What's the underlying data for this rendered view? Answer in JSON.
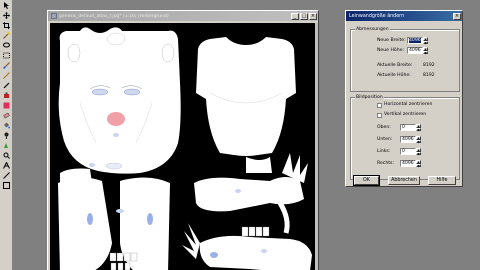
{
  "image_window": {
    "title": "genesis_default_atlas_f.jpg* (1:16) (Hintergrund)",
    "minimize": "_",
    "maximize": "□",
    "close": "×"
  },
  "dialog": {
    "title": "Leinwandgröße ändern",
    "close": "×",
    "dimensions_group": "Abmessungen",
    "new_width_label": "Neue Breite:",
    "new_width_value": "4096",
    "new_height_label": "Neue Höhe:",
    "new_height_value": "4096",
    "current_width_label": "Aktuelle Breite:",
    "current_width_value": "8192",
    "current_height_label": "Aktuelle Höhe:",
    "current_height_value": "8192",
    "position_group": "Bildposition",
    "center_horizontal_label": "Horizontal zentrieren",
    "center_vertical_label": "Vertikal zentrieren",
    "top_label": "Oben:",
    "top_value": "0",
    "bottom_label": "Unten:",
    "bottom_value": "4096",
    "left_label": "Links:",
    "left_value": "0",
    "right_label": "Rechts:",
    "right_value": "4096",
    "ok_label": "OK",
    "cancel_label": "Abbrechen",
    "help_label": "Hilfe"
  },
  "toolbox": {
    "tools": [
      "pointer-tool",
      "move-tool",
      "crop-tool",
      "magic-wand-tool",
      "lasso-tool",
      "selection-tool",
      "brush-tool",
      "pencil-tool",
      "eyedropper-tool",
      "clone-tool",
      "color-tool",
      "eraser-tool",
      "fill-tool",
      "dodge-tool",
      "smudge-tool",
      "zoom-tool",
      "text-tool",
      "line-tool",
      "shape-tool"
    ]
  }
}
